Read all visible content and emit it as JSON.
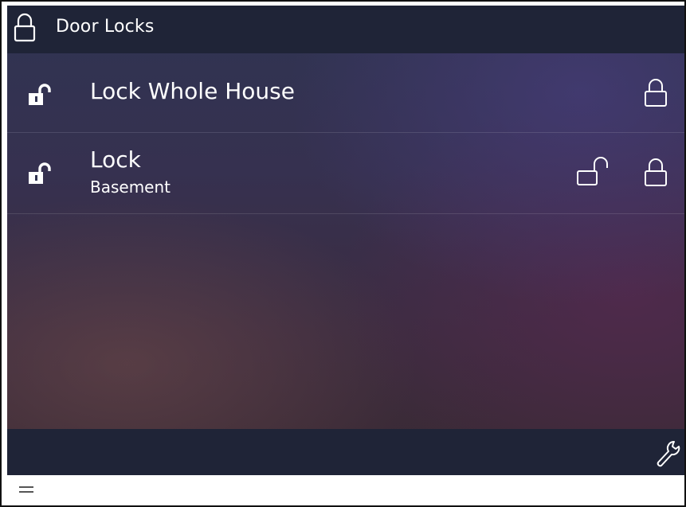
{
  "header": {
    "title": "Door Locks",
    "icon": "padlock-icon"
  },
  "locks": [
    {
      "title": "Lock Whole House",
      "subtitle": "",
      "status_icon": "unlocked-padlock-icon",
      "actions": [
        "lock"
      ]
    },
    {
      "title": "Lock",
      "subtitle": "Basement",
      "status_icon": "unlocked-padlock-icon",
      "actions": [
        "unlock",
        "lock"
      ]
    }
  ],
  "footer": {
    "settings_icon": "wrench-icon"
  },
  "bottom_bar": {
    "menu_icon": "hamburger-menu-icon"
  },
  "colors": {
    "header_bg": "#1f2437",
    "text": "#ffffff",
    "icon": "#ffffff"
  }
}
